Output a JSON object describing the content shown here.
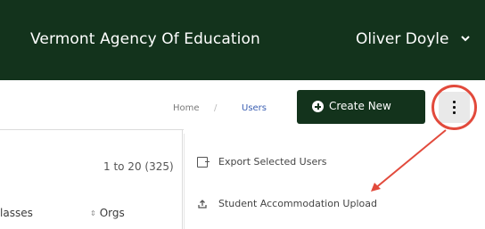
{
  "topbar": {
    "org_name": "Vermont Agency Of Education",
    "user_name": "Oliver Doyle"
  },
  "breadcrumb": {
    "home": "Home",
    "separator": "/",
    "current": "Users"
  },
  "actions": {
    "create_label": "Create New",
    "more_icon": "vertical-ellipsis-icon"
  },
  "table": {
    "count_text": "1 to 20 (325)",
    "columns": [
      "lasses",
      "Orgs"
    ]
  },
  "menu": {
    "items": [
      {
        "label": "Export Selected Users",
        "icon": "export-icon"
      },
      {
        "label": "Student Accommodation Upload",
        "icon": "upload-icon"
      }
    ]
  },
  "colors": {
    "brand_dark_green": "#13331c",
    "highlight_red": "#e24a3c",
    "link_blue": "#3b5fb2"
  }
}
